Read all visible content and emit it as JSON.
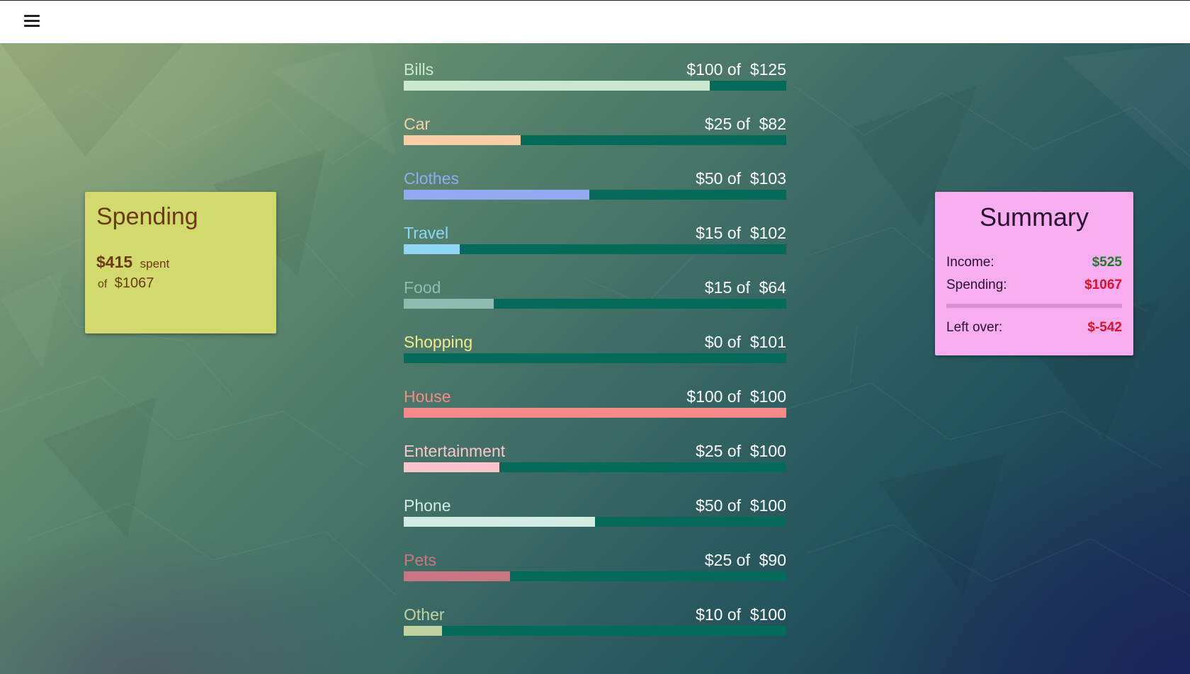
{
  "topbar": {
    "menu_icon": "hamburger-menu-icon"
  },
  "spending_card": {
    "title": "Spending",
    "amount_spent": "$415",
    "spent_word": "spent",
    "of_word": "of",
    "total": "$1067"
  },
  "summary_card": {
    "title": "Summary",
    "income_label": "Income:",
    "income_value": "$525",
    "spending_label": "Spending:",
    "spending_value": "$1067",
    "leftover_label": "Left over:",
    "leftover_value": "$-542"
  },
  "categories": [
    {
      "name": "Bills",
      "amount": "$100 of  $125",
      "spent": 100,
      "budget": 125,
      "color": "#c9e8cf"
    },
    {
      "name": "Car",
      "amount": "$25 of  $82",
      "spent": 25,
      "budget": 82,
      "color": "#f8cfa6"
    },
    {
      "name": "Clothes",
      "amount": "$50 of  $103",
      "spent": 50,
      "budget": 103,
      "color": "#93aaf0"
    },
    {
      "name": "Travel",
      "amount": "$15 of  $102",
      "spent": 15,
      "budget": 102,
      "color": "#8fd6f4"
    },
    {
      "name": "Food",
      "amount": "$15 of  $64",
      "spent": 15,
      "budget": 64,
      "color": "#8fbcb0"
    },
    {
      "name": "Shopping",
      "amount": "$0 of  $101",
      "spent": 0,
      "budget": 101,
      "color": "#f3ea8a"
    },
    {
      "name": "House",
      "amount": "$100 of  $100",
      "spent": 100,
      "budget": 100,
      "color": "#f48a8a"
    },
    {
      "name": "Entertainment",
      "amount": "$25 of  $100",
      "spent": 25,
      "budget": 100,
      "color": "#f8c6cc"
    },
    {
      "name": "Phone",
      "amount": "$50 of  $100",
      "spent": 50,
      "budget": 100,
      "color": "#d3ece3"
    },
    {
      "name": "Pets",
      "amount": "$25 of  $90",
      "spent": 25,
      "budget": 90,
      "color": "#c77682"
    },
    {
      "name": "Other",
      "amount": "$10 of  $100",
      "spent": 10,
      "budget": 100,
      "color": "#bfd3a0"
    }
  ]
}
